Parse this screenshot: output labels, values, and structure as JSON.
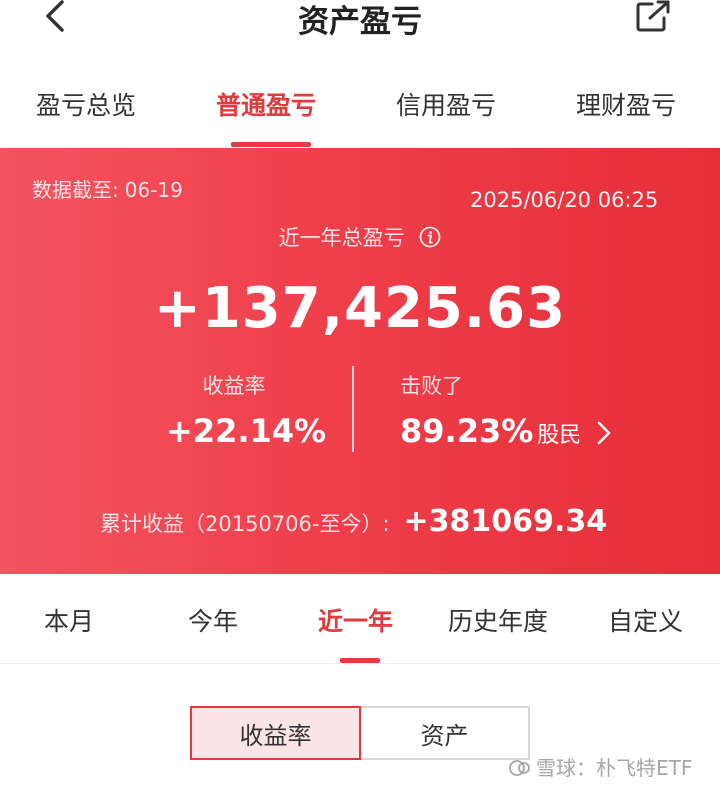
{
  "header": {
    "title": "资产盈亏"
  },
  "top_tabs": [
    {
      "label": "盈亏总览"
    },
    {
      "label": "普通盈亏"
    },
    {
      "label": "信用盈亏"
    },
    {
      "label": "理财盈亏"
    }
  ],
  "summary": {
    "as_of_label": "数据截至:",
    "as_of_value": "06-19",
    "timestamp": "2025/06/20 06:25",
    "total_label": "近一年总盈亏",
    "total_value": "+137,425.63",
    "return_label": "收益率",
    "return_value": "+22.14%",
    "beat_label": "击败了",
    "beat_value": "89.23%",
    "beat_unit": "股民",
    "cumulative_label": "累计收益（20150706-至今）:",
    "cumulative_value": "+381069.34"
  },
  "period_tabs": [
    {
      "label": "本月"
    },
    {
      "label": "今年"
    },
    {
      "label": "近一年"
    },
    {
      "label": "历史年度"
    },
    {
      "label": "自定义"
    }
  ],
  "toggle": {
    "return_label": "收益率",
    "asset_label": "资产"
  },
  "watermark": {
    "text": "雪球：朴飞特ETF"
  },
  "colors": {
    "accent": "#e23a3f",
    "banner_start": "#f35460",
    "banner_end": "#e62e38",
    "toggle_active_bg": "#fde5e6"
  },
  "icons": {
    "back": "chevron-left-icon",
    "share": "share-icon",
    "info": "info-icon",
    "more": "chevron-right-icon"
  }
}
